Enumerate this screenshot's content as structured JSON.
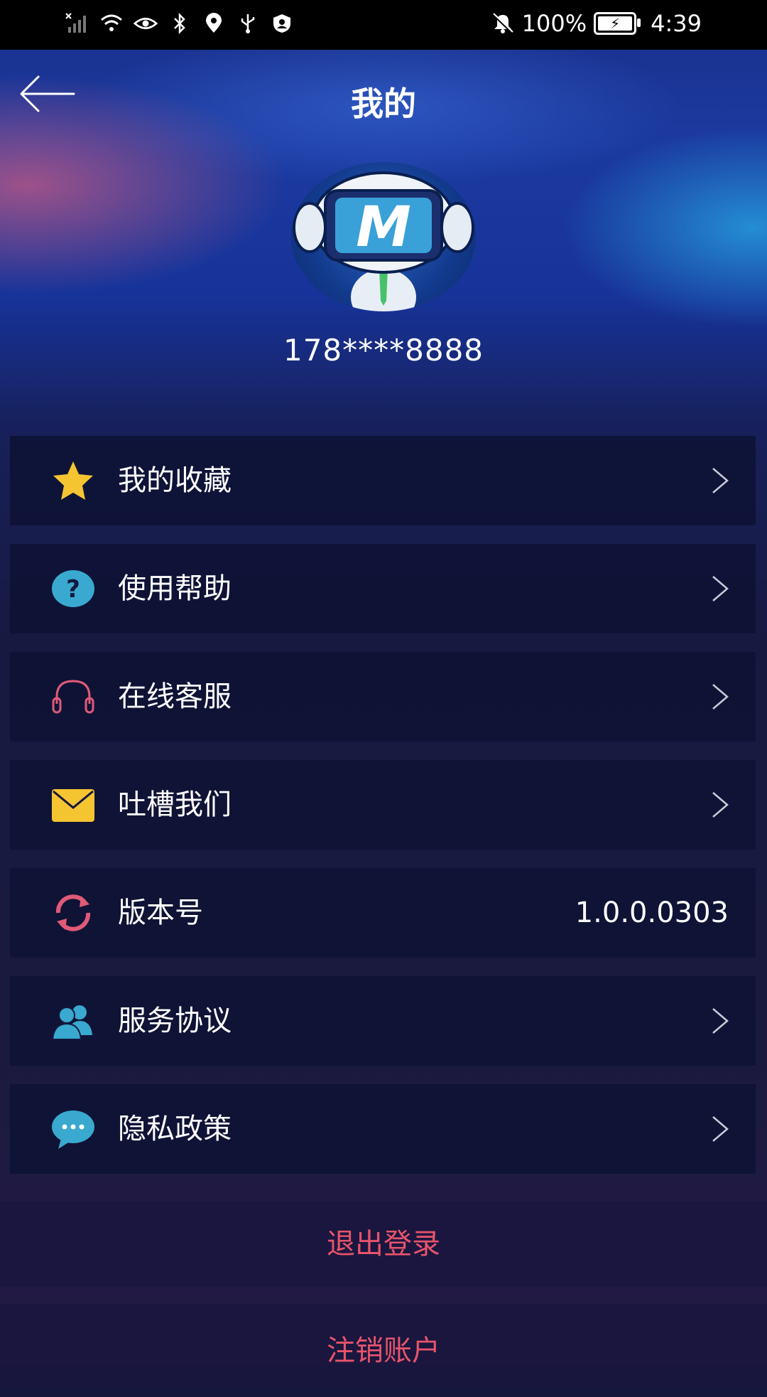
{
  "status_bar": {
    "battery": "100%",
    "time": "4:39",
    "icons": [
      "signal-off-icon",
      "wifi-icon",
      "eye-icon",
      "bluetooth-icon",
      "location-icon",
      "usb-icon",
      "user-shield-icon",
      "mute-bell-icon",
      "battery-charging-icon"
    ]
  },
  "header": {
    "title": "我的",
    "back_icon": "arrow-left-icon"
  },
  "profile": {
    "phone": "178****8888",
    "avatar_letter": "M"
  },
  "menu": {
    "items": [
      {
        "label": "我的收藏",
        "icon": "star-icon",
        "color": "#f5c431"
      },
      {
        "label": "使用帮助",
        "icon": "help-circle-icon",
        "color": "#39a9cf"
      },
      {
        "label": "在线客服",
        "icon": "headphones-icon",
        "color": "#e05a78"
      },
      {
        "label": "吐槽我们",
        "icon": "mail-icon",
        "color": "#f5c431"
      },
      {
        "label": "版本号",
        "icon": "refresh-icon",
        "color": "#e05a78",
        "value": "1.0.0.0303"
      },
      {
        "label": "服务协议",
        "icon": "users-icon",
        "color": "#39a9cf"
      },
      {
        "label": "隐私政策",
        "icon": "chat-bubble-icon",
        "color": "#39a9cf"
      }
    ]
  },
  "actions": {
    "logout": "退出登录",
    "deregister": "注销账户"
  },
  "colors": {
    "accent_red": "#e7546b",
    "menu_bg": "#0e1234"
  }
}
